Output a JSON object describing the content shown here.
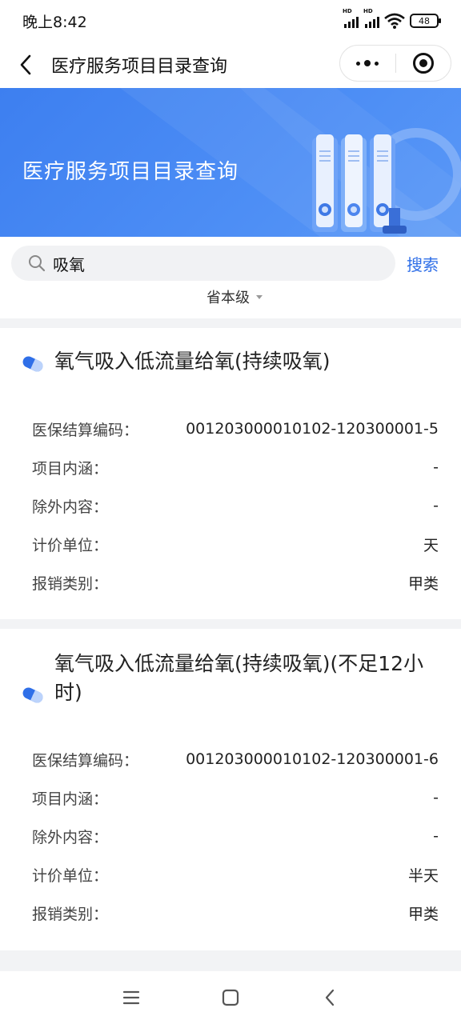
{
  "status_bar": {
    "time": "晚上8:42",
    "battery": "48",
    "signal_label": "HD"
  },
  "nav": {
    "title": "医疗服务项目目录查询"
  },
  "banner": {
    "title": "医疗服务项目目录查询",
    "accent_color": "#4a8af4"
  },
  "search": {
    "value": "吸氧",
    "button_label": "搜索"
  },
  "filter": {
    "label": "省本级"
  },
  "items": [
    {
      "title": "氧气吸入低流量给氧(持续吸氧)",
      "fields": [
        {
          "label": "医保结算编码：",
          "value": "001203000010102-120300001-5"
        },
        {
          "label": "项目内涵：",
          "value": "-"
        },
        {
          "label": "除外内容：",
          "value": "-"
        },
        {
          "label": "计价单位：",
          "value": "天"
        },
        {
          "label": "报销类别：",
          "value": "甲类"
        }
      ]
    },
    {
      "title": "氧气吸入低流量给氧(持续吸氧)(不足12小时)",
      "fields": [
        {
          "label": "医保结算编码：",
          "value": "001203000010102-120300001-6"
        },
        {
          "label": "项目内涵：",
          "value": "-"
        },
        {
          "label": "除外内容：",
          "value": "-"
        },
        {
          "label": "计价单位：",
          "value": "半天"
        },
        {
          "label": "报销类别：",
          "value": "甲类"
        }
      ]
    }
  ]
}
